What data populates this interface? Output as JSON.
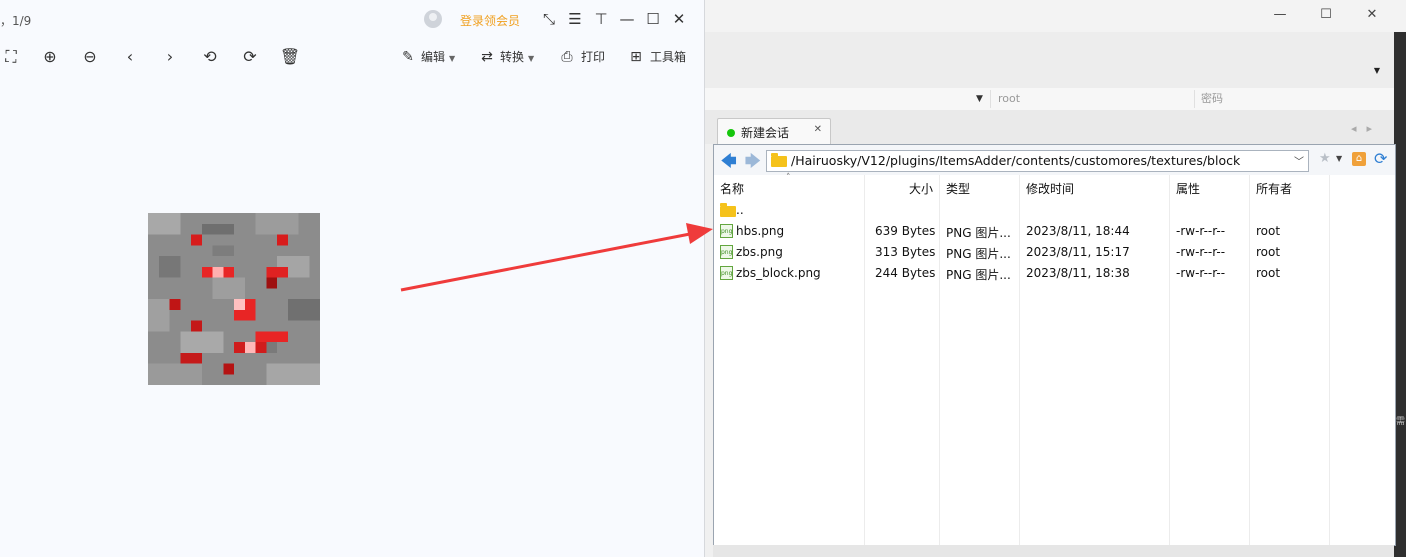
{
  "viewer": {
    "index_text": "，1/9",
    "login_link": "登录领会员",
    "toolbar": {
      "edit": "编辑",
      "convert": "转换",
      "print": "打印",
      "toolbox": "工具箱"
    }
  },
  "sftp": {
    "login": {
      "user_value": "root",
      "password_placeholder": "密码"
    },
    "tab": {
      "label": "新建会话",
      "status_color": "#16c60c"
    },
    "path": "/Hairuosky/V12/plugins/ItemsAdder/contents/customores/textures/block",
    "columns": {
      "name": "名称",
      "size": "大小",
      "type": "类型",
      "modified": "修改时间",
      "perm": "属性",
      "owner": "所有者"
    },
    "parent_row": "..",
    "files": [
      {
        "name": "hbs.png",
        "size": "639 Bytes",
        "type": "PNG 图片...",
        "modified": "2023/8/11, 18:44",
        "perm": "-rw-r--r--",
        "owner": "root"
      },
      {
        "name": "zbs.png",
        "size": "313 Bytes",
        "type": "PNG 图片...",
        "modified": "2023/8/11, 15:17",
        "perm": "-rw-r--r--",
        "owner": "root"
      },
      {
        "name": "zbs_block.png",
        "size": "244 Bytes",
        "type": "PNG 图片...",
        "modified": "2023/8/11, 18:38",
        "perm": "-rw-r--r--",
        "owner": "root"
      }
    ],
    "edge_text": "需"
  },
  "annotation": {
    "arrow_color": "#ef3b3b"
  },
  "colors": {
    "accent_orange": "#f0a020",
    "folder_yellow": "#f5c21b",
    "nav_blue": "#2f7fd3"
  }
}
